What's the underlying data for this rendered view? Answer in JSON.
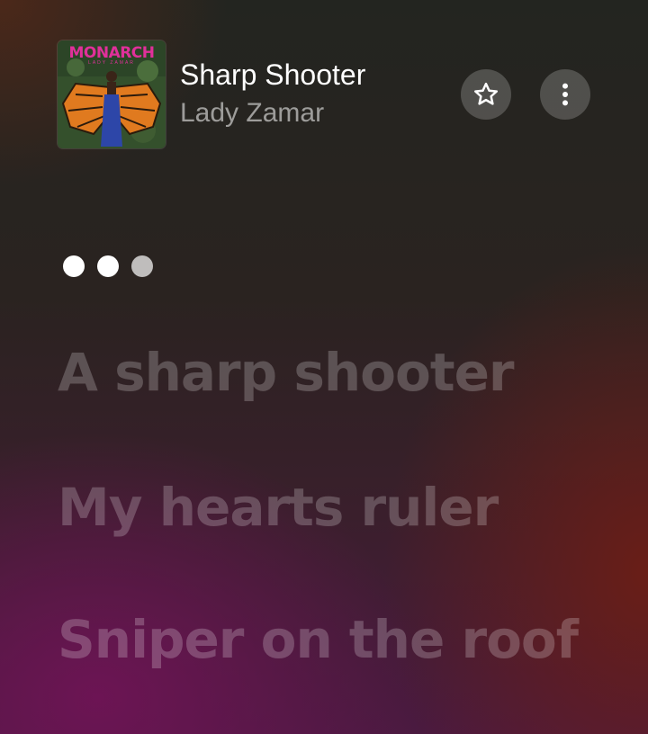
{
  "now_playing": {
    "title": "Sharp Shooter",
    "artist": "Lady Zamar",
    "artwork": {
      "title_text": "MONARCH",
      "subtitle_text": "LADY ZAMAR"
    }
  },
  "buttons": {
    "favorite_icon": "star-outline-icon",
    "more_icon": "vertical-ellipsis-icon"
  },
  "lyrics": {
    "lines": [
      "A sharp shooter",
      "My hearts ruler",
      "Sniper on the roof"
    ]
  },
  "colors": {
    "text_primary": "#ffffff",
    "text_secondary": "rgba(255,255,255,0.55)",
    "lyric_inactive": "rgba(255,255,255,0.22)",
    "button_bg": "rgba(255,255,255,0.2)"
  }
}
